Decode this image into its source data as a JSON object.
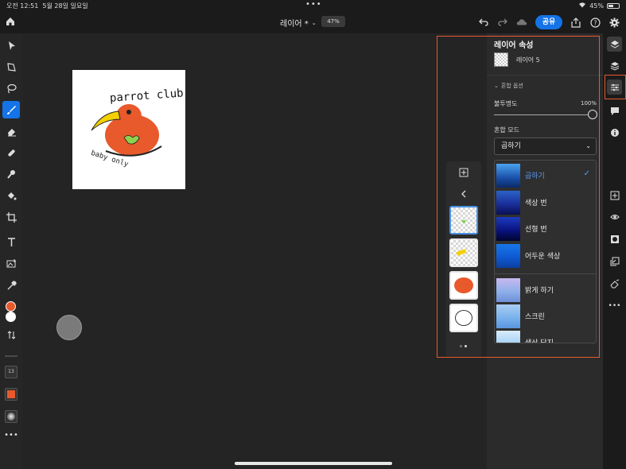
{
  "status": {
    "time": "오전 12:51",
    "date": "5월 28일 일요일",
    "battery": "45%"
  },
  "topbar": {
    "doc_title": "레이어 *",
    "zoom": "47%",
    "share_label": "공유"
  },
  "properties": {
    "title": "레이어 속성",
    "layer_name": "레이어 5",
    "blend_section": "혼합 옵션",
    "opacity_label": "불투명도",
    "opacity_value": "100%",
    "opacity_fraction": 1.0,
    "blend_mode_label": "혼합 모드",
    "blend_mode_selected": "곱하기"
  },
  "blend_modes": [
    {
      "label": "곱하기",
      "selected": true
    },
    {
      "label": "색상 번",
      "selected": false
    },
    {
      "label": "선형 번",
      "selected": false
    },
    {
      "label": "어두운 색상",
      "selected": false
    },
    {
      "label": "밝게 하기",
      "selected": false
    },
    {
      "label": "스크린",
      "selected": false
    },
    {
      "label": "색상 닷지",
      "selected": false
    }
  ],
  "left_tools": {
    "brush_size": "13"
  },
  "artwork": {
    "title_text": "parrot club",
    "subtitle_text": "baby only"
  },
  "colors": {
    "accent": "#1473e6",
    "highlight": "#e8592b",
    "foreground": "#e8592b",
    "background": "#ffffff"
  }
}
